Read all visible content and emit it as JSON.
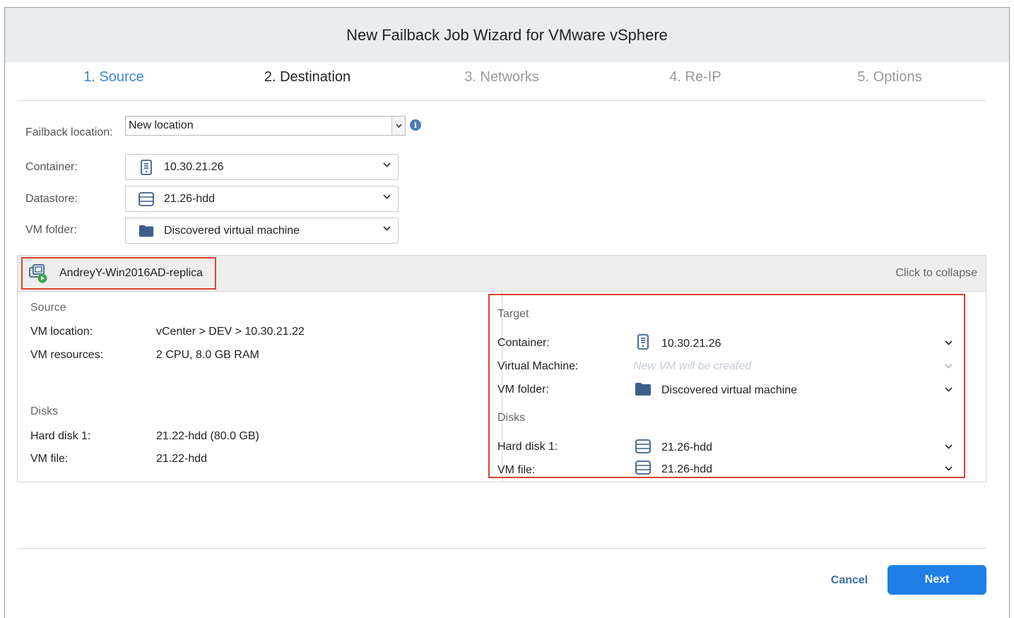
{
  "window": {
    "title": "New Failback Job Wizard for VMware vSphere"
  },
  "steps": [
    {
      "label": "1. Source",
      "state": "active"
    },
    {
      "label": "2. Destination",
      "state": "current"
    },
    {
      "label": "3. Networks",
      "state": "disabled"
    },
    {
      "label": "4. Re-IP",
      "state": "disabled"
    },
    {
      "label": "5. Options",
      "state": "disabled"
    }
  ],
  "form": {
    "failback_location": {
      "label": "Failback location:",
      "value": "New location"
    },
    "container": {
      "label": "Container:",
      "value": "10.30.21.26",
      "icon": "server-icon"
    },
    "datastore": {
      "label": "Datastore:",
      "value": "21.26-hdd",
      "icon": "datastore-icon"
    },
    "vm_folder": {
      "label": "VM folder:",
      "value": "Discovered virtual machine",
      "icon": "folder-icon"
    }
  },
  "vm_panel": {
    "vm_name": "AndreyY-Win2016AD-replica",
    "vm_icon": "vm-replica-icon",
    "collapse_label": "Click to collapse",
    "source": {
      "title": "Source",
      "vm_location_label": "VM location:",
      "vm_location_value": "vCenter > DEV > 10.30.21.22",
      "vm_resources_label": "VM resources:",
      "vm_resources_value": "2 CPU, 8.0 GB RAM",
      "disks_title": "Disks",
      "hard_disk_label": "Hard disk 1:",
      "hard_disk_value": "21.22-hdd (80.0 GB)",
      "vm_file_label": "VM file:",
      "vm_file_value": "21.22-hdd"
    },
    "target": {
      "title": "Target",
      "container_label": "Container:",
      "container_value": "10.30.21.26",
      "virtual_machine_label": "Virtual Machine:",
      "virtual_machine_placeholder": "New VM will be created",
      "vm_folder_label": "VM folder:",
      "vm_folder_value": "Discovered virtual machine",
      "disks_title": "Disks",
      "hard_disk_label": "Hard disk 1:",
      "hard_disk_value": "21.26-hdd",
      "vm_file_label": "VM file:",
      "vm_file_value": "21.26-hdd"
    }
  },
  "footer": {
    "cancel_label": "Cancel",
    "next_label": "Next"
  },
  "colors": {
    "accent": "#1f7fe6",
    "step_active": "#3a86d1",
    "highlight": "#d9432f",
    "folder": "#3c5f8a"
  }
}
